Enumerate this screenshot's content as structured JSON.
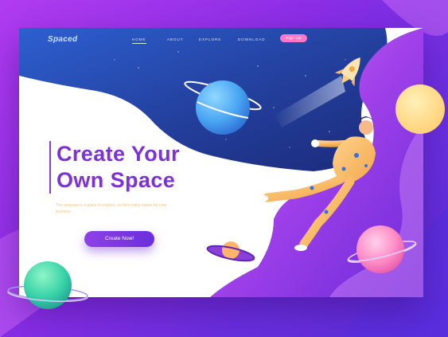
{
  "nav": {
    "logo": "Spaced",
    "links": [
      "Home",
      "About",
      "Explore",
      "Download"
    ],
    "cta": "Sign Up"
  },
  "hero": {
    "title_line1": "Create Your",
    "title_line2": "Own Space",
    "description": "The universe is a place to explore, so let's make space for new journeys.",
    "button": "Create Now!"
  },
  "colors": {
    "accent": "#7b33d8",
    "background": "#9b35ea",
    "cta_pink": "#ff77c8",
    "nav_blue": "#2a4fbf"
  },
  "icons": {
    "rocket": "rocket-icon",
    "planets": [
      "blue-planet",
      "yellow-planet",
      "green-planet",
      "pink-planet",
      "saturn-planet"
    ],
    "astronaut": "astronaut-illustration"
  }
}
